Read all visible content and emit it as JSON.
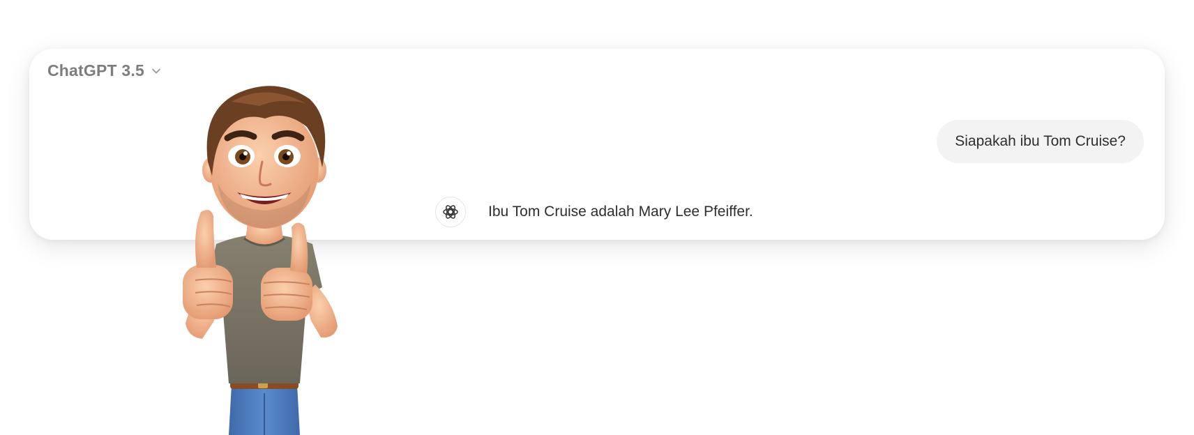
{
  "header": {
    "model_label": "ChatGPT 3.5",
    "model_dropdown_icon": "chevron-down-icon"
  },
  "conversation": {
    "user_message": "Siapakah ibu Tom Cruise?",
    "assistant_icon": "openai-logo-icon",
    "assistant_message": "Ibu Tom Cruise adalah Mary Lee Pfeiffer."
  },
  "colors": {
    "card_background": "#ffffff",
    "user_bubble": "#f3f3f3",
    "text_primary": "#2e2e2e",
    "text_muted": "#7d7d7d",
    "shirt": "#7a7566",
    "jeans": "#4a7bbf",
    "hair": "#6b3f22",
    "skin": "#f2b892"
  }
}
